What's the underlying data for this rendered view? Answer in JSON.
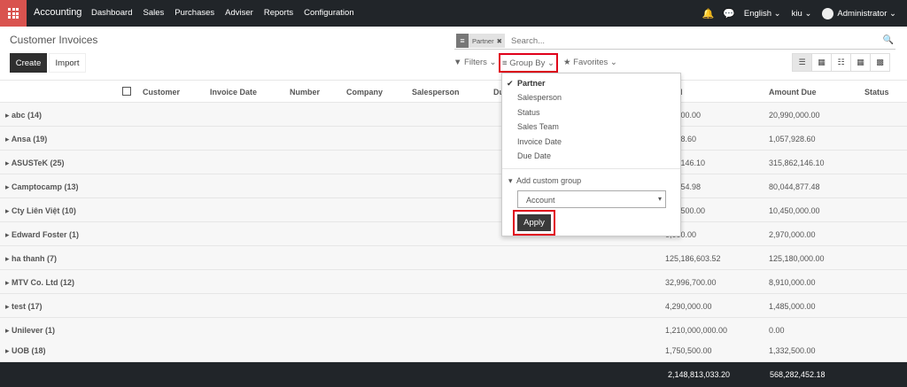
{
  "navbar": {
    "brand": "Accounting",
    "menu": [
      "Dashboard",
      "Sales",
      "Purchases",
      "Adviser",
      "Reports",
      "Configuration"
    ],
    "language": "English",
    "user_short": "kiu",
    "user": "Administrator"
  },
  "control": {
    "title": "Customer Invoices",
    "create": "Create",
    "import": "Import",
    "facet": "Partner",
    "search_placeholder": "Search...",
    "filters": "Filters",
    "group_by": "Group By",
    "favorites": "Favorites"
  },
  "table": {
    "headers": {
      "customer": "Customer",
      "invoice_date": "Invoice Date",
      "number": "Number",
      "company": "Company",
      "salesperson": "Salesperson",
      "due": "Du",
      "total": "l",
      "amount_due": "Amount Due",
      "status": "Status"
    },
    "groups": [
      {
        "name": "abc (14)",
        "total": "18,300.00",
        "due": "20,990,000.00"
      },
      {
        "name": "Ansa (19)",
        "total": "0,028.60",
        "due": "1,057,928.60"
      },
      {
        "name": "ASUSTeK (25)",
        "total": "553,146.10",
        "due": "315,862,146.10"
      },
      {
        "name": "Camptocamp (13)",
        "total": "74,254.98",
        "due": "80,044,877.48"
      },
      {
        "name": "Cty Liên Việt (10)",
        "total": "023,500.00",
        "due": "10,450,000.00"
      },
      {
        "name": "Edward Foster (1)",
        "total": "0,000.00",
        "due": "2,970,000.00"
      },
      {
        "name": "ha thanh (7)",
        "total": "125,186,603.52",
        "due": "125,180,000.00"
      },
      {
        "name": "MTV Co. Ltd (12)",
        "total": "32,996,700.00",
        "due": "8,910,000.00"
      },
      {
        "name": "test (17)",
        "total": "4,290,000.00",
        "due": "1,485,000.00"
      },
      {
        "name": "Unilever (1)",
        "total": "1,210,000,000.00",
        "due": "0.00"
      },
      {
        "name": "UOB (18)",
        "total": "1,750,500.00",
        "due": "1,332,500.00"
      }
    ],
    "footer_total": "2,148,813,033.20",
    "footer_due": "568,282,452.18"
  },
  "groupby_menu": {
    "items": [
      "Partner",
      "Salesperson",
      "Status",
      "Sales Team",
      "Invoice Date",
      "Due Date"
    ],
    "custom_label": "Add custom group",
    "custom_value": "Account",
    "apply": "Apply"
  },
  "colors": {
    "navbar": "#212529",
    "app_switcher": "#d9534f",
    "highlight": "#e0001a"
  }
}
